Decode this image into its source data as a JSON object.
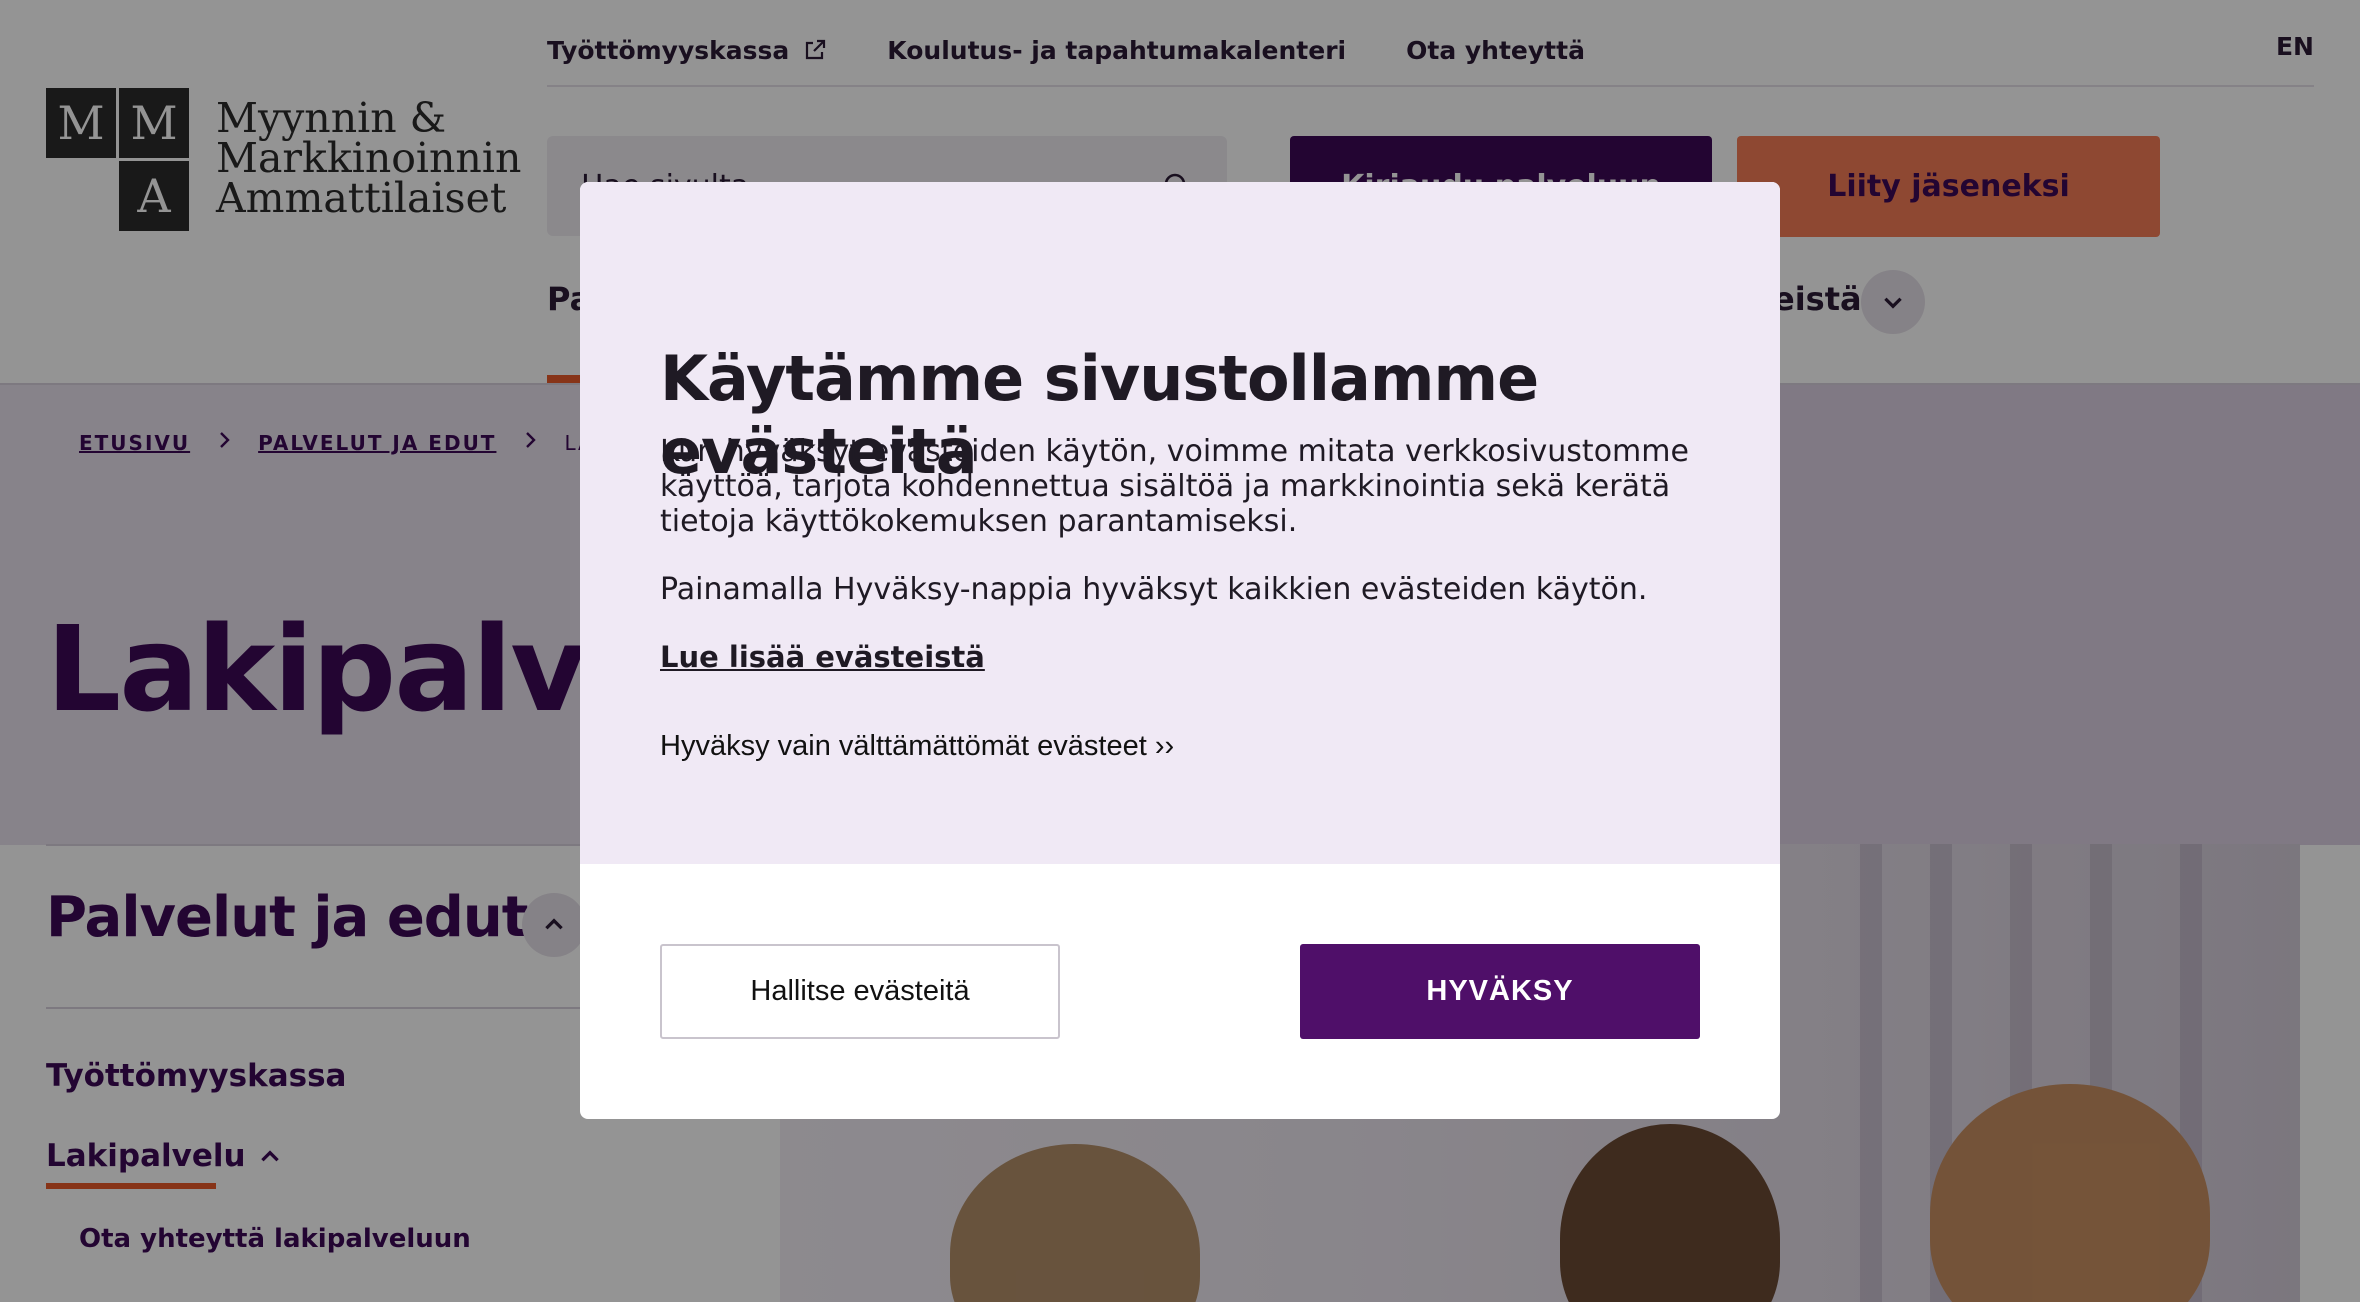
{
  "header": {
    "links": [
      {
        "label": "Työttömyyskassa",
        "external": true
      },
      {
        "label": "Koulutus- ja tapahtumakalenteri",
        "external": false
      },
      {
        "label": "Ota yhteyttä",
        "external": false
      }
    ],
    "language": "EN",
    "logo": {
      "letters": [
        "M",
        "M",
        "A"
      ],
      "line1": "Myynnin &",
      "line2": "Markkinoinnin",
      "line3": "Ammattilaiset"
    },
    "search": {
      "placeholder": "Hae sivulta"
    },
    "login_button": "Kirjaudu palveluun",
    "join_button": "Liity jäseneksi",
    "nav": {
      "first_visible": "Pa",
      "last_visible": "eistä"
    }
  },
  "breadcrumb": {
    "items": [
      "ETUSIVU",
      "PALVELUT JA EDUT"
    ],
    "current": "LAK"
  },
  "page": {
    "title": "Lakipalvel"
  },
  "sidebar": {
    "title": "Palvelut ja edut",
    "items": [
      {
        "label": "Työttömyyskassa"
      },
      {
        "label": "Lakipalvelu",
        "active": true
      }
    ],
    "sub_item": "Ota yhteyttä lakipalveluun"
  },
  "cookie_modal": {
    "title": "Käytämme sivustollamme evästeitä",
    "paragraph1": "Kun hyväksyt evästeiden käytön, voimme mitata verkkosivustomme käyttöä, tarjota kohdennettua sisältöä ja markkinointia sekä kerätä tietoja käyttökokemuksen parantamiseksi.",
    "paragraph2": "Painamalla Hyväksy-nappia hyväksyt kaikkien evästeiden käytön.",
    "read_more": "Lue lisää evästeistä",
    "necessary_only": "Hyväksy vain välttämättömät evästeet ››",
    "manage_button": "Hallitse evästeitä",
    "accept_button": "HYVÄKSY"
  },
  "colors": {
    "brand_purple": "#3d0a57",
    "accept_purple": "#4f0f69",
    "accent_orange": "#f47c56",
    "modal_bg": "#f0e9f5"
  }
}
